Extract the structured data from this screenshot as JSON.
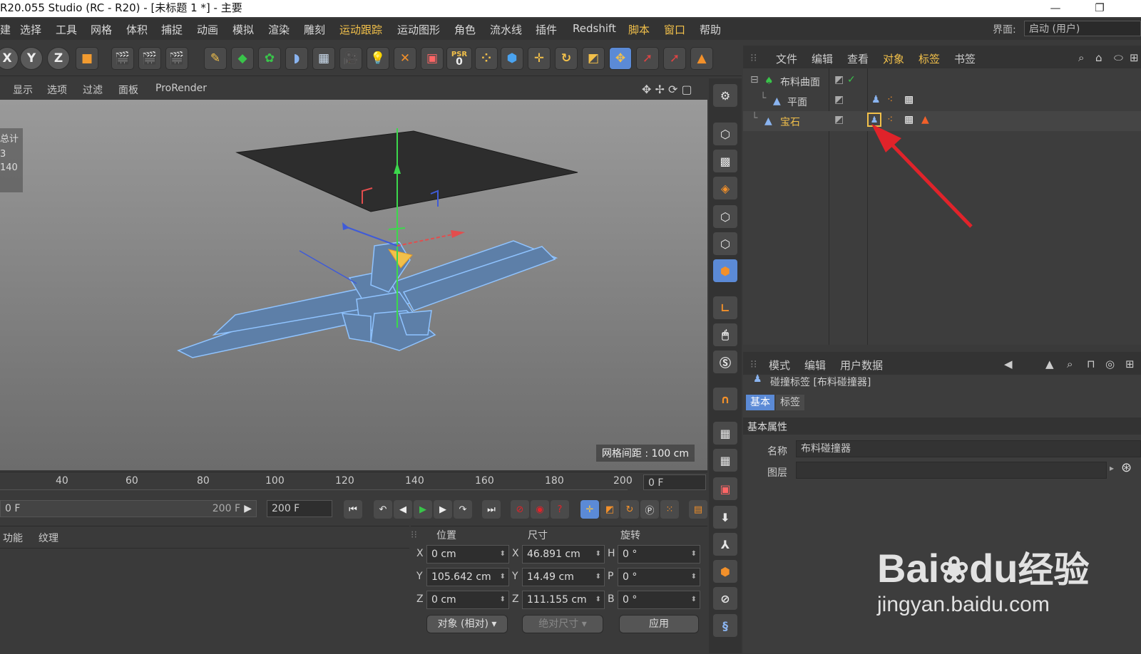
{
  "window": {
    "title": "R20.055 Studio (RC - R20) - [未标题 1 *] - 主要",
    "minimize_glyph": "—",
    "restore_glyph": "❐"
  },
  "menubar": {
    "items": [
      "建",
      "选择",
      "工具",
      "网格",
      "体积",
      "捕捉",
      "动画",
      "模拟",
      "渲染",
      "雕刻",
      "运动跟踪",
      "运动图形",
      "角色",
      "流水线",
      "插件",
      "Redshift",
      "脚本",
      "窗口",
      "帮助"
    ],
    "layout_label": "界面:",
    "layout_value": "启动 (用户)"
  },
  "toolbar": {
    "axis_x": "X",
    "axis_y": "Y",
    "axis_z": "Z",
    "psr_label": "PSR",
    "psr_value": "0"
  },
  "viewport_menu": [
    "显示",
    "选项",
    "过滤",
    "面板",
    "ProRender"
  ],
  "viewport": {
    "stats_label": "总计",
    "stats_values": [
      "3",
      "140"
    ],
    "grid_spacing": "网格间距 : 100 cm"
  },
  "object_manager": {
    "menu": [
      "文件",
      "编辑",
      "查看",
      "对象",
      "标签",
      "书签"
    ],
    "objects": [
      {
        "name": "布料曲面",
        "color": "#bdbdbd"
      },
      {
        "name": "平面",
        "color": "#e0e0e0"
      },
      {
        "name": "宝石",
        "color": "#f2c04a"
      }
    ]
  },
  "attribute_manager": {
    "menu": [
      "模式",
      "编辑",
      "用户数据"
    ],
    "tag_title": "碰撞标签 [布料碰撞器]",
    "tabs": [
      "基本",
      "标签"
    ],
    "section": "基本属性",
    "name_label": "名称",
    "name_value": "布料碰撞器",
    "layer_label": "图层",
    "layer_value": ""
  },
  "timeline": {
    "ticks": [
      "40",
      "60",
      "80",
      "100",
      "120",
      "140",
      "160",
      "180",
      "200"
    ],
    "current_frame": "0 F"
  },
  "transport": {
    "range_start": "0 F",
    "range_end": "200 F",
    "end_frame": "200 F"
  },
  "material_manager": {
    "menu": [
      "功能",
      "纹理"
    ]
  },
  "coordinates": {
    "headers": {
      "position": "位置",
      "size": "尺寸",
      "rotation": "旋转"
    },
    "rows": [
      {
        "axis": "X",
        "pos": "0 cm",
        "size_axis": "X",
        "size": "46.891 cm",
        "rot_axis": "H",
        "rot": "0 °"
      },
      {
        "axis": "Y",
        "pos": "105.642 cm",
        "size_axis": "Y",
        "size": "14.49 cm",
        "rot_axis": "P",
        "rot": "0 °"
      },
      {
        "axis": "Z",
        "pos": "0 cm",
        "size_axis": "Z",
        "size": "111.155 cm",
        "rot_axis": "B",
        "rot": "0 °"
      }
    ],
    "mode_select": "对象 (相对)",
    "size_select": "绝对尺寸",
    "apply_label": "应用"
  },
  "watermark": {
    "brand_left": "Bai",
    "brand_mid": "du",
    "brand_right": "经验",
    "url": "jingyan.baidu.com"
  },
  "colors": {
    "accent_yellow": "#f2c04a",
    "arrow_red": "#e0232a",
    "mesh_blue": "#5d7fa8",
    "play_green": "#39c44a"
  }
}
